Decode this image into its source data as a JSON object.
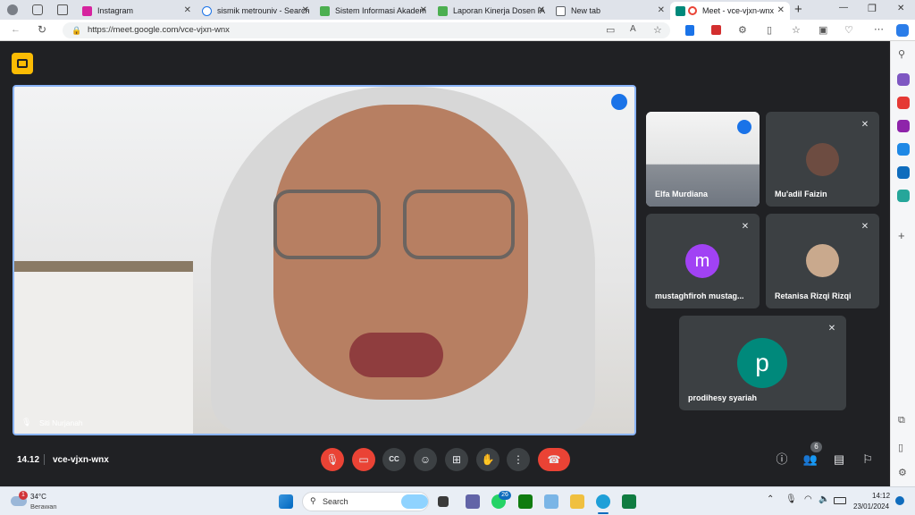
{
  "browser": {
    "tabs": [
      {
        "label": "Instagram",
        "color": "#d6249f"
      },
      {
        "label": "sismik metrouniv - Search",
        "color": "#1a73e8"
      },
      {
        "label": "Sistem Informasi Akadem",
        "color": "#4caf50"
      },
      {
        "label": "Laporan Kinerja Dosen IA",
        "color": "#4caf50"
      },
      {
        "label": "New tab",
        "color": "#5f6368"
      },
      {
        "label": "Meet - vce-vjxn-wnx",
        "color": "#00897b"
      }
    ],
    "url": "https://meet.google.com/vce-vjxn-wnx",
    "new_tab": "+",
    "win_min": "—",
    "win_max": "❐",
    "win_close": "✕"
  },
  "meet": {
    "main_speaker": "Siti Nurjanah",
    "time": "14.12",
    "meeting_code": "vce-vjxn-wnx",
    "participants_count": "6",
    "participants": [
      {
        "name": "Elfa Murdiana",
        "type": "video"
      },
      {
        "name": "Mu'adil Faizin",
        "type": "photo"
      },
      {
        "name": "mustaghfiroh mustag...",
        "type": "letter",
        "letter": "m",
        "color": "#a142f4"
      },
      {
        "name": "Retanisa Rizqi Rizqi",
        "type": "photo"
      },
      {
        "name": "prodihesy syariah",
        "type": "letter",
        "letter": "p",
        "color": "#00897b"
      }
    ],
    "controls": [
      "mic-off",
      "camera-off",
      "captions",
      "emoji",
      "present",
      "raise-hand",
      "more",
      "leave"
    ],
    "right_controls": [
      "info",
      "people",
      "chat",
      "activities"
    ]
  },
  "taskbar": {
    "weather_temp": "34°C",
    "weather_desc": "Berawan",
    "search_placeholder": "Search",
    "time": "14:12",
    "date": "23/01/2024",
    "badge_weather": "1",
    "badge_whatsapp": "26"
  }
}
